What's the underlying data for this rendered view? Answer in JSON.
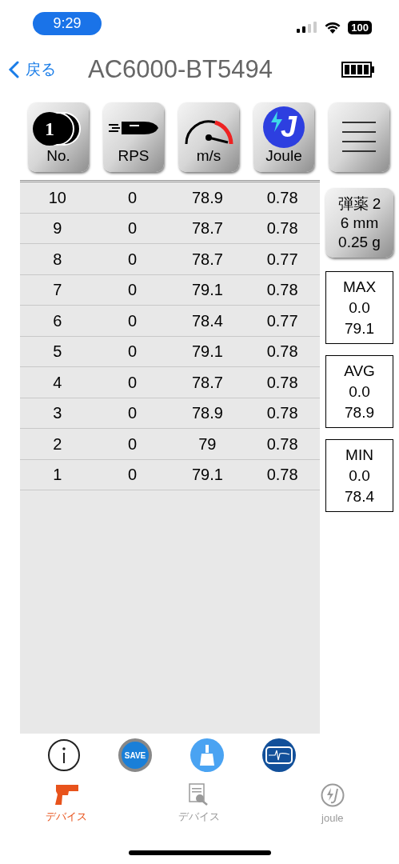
{
  "status_bar": {
    "time": "9:29",
    "battery": "100"
  },
  "nav": {
    "back": "戻る",
    "title": "AC6000-BT5494"
  },
  "toolbar": [
    {
      "kind": "number",
      "label": "No.",
      "glyph": "1"
    },
    {
      "kind": "rps",
      "label": "RPS"
    },
    {
      "kind": "speed",
      "label": "m/s"
    },
    {
      "kind": "joule",
      "label": "Joule",
      "glyph": "J"
    },
    {
      "kind": "menu"
    }
  ],
  "table": {
    "rows": [
      [
        "10",
        "0",
        "78.9",
        "0.78"
      ],
      [
        "9",
        "0",
        "78.7",
        "0.78"
      ],
      [
        "8",
        "0",
        "78.7",
        "0.77"
      ],
      [
        "7",
        "0",
        "79.1",
        "0.78"
      ],
      [
        "6",
        "0",
        "78.4",
        "0.77"
      ],
      [
        "5",
        "0",
        "79.1",
        "0.78"
      ],
      [
        "4",
        "0",
        "78.7",
        "0.78"
      ],
      [
        "3",
        "0",
        "78.9",
        "0.78"
      ],
      [
        "2",
        "0",
        "79",
        "0.78"
      ],
      [
        "1",
        "0",
        "79.1",
        "0.78"
      ]
    ]
  },
  "ammo_button": [
    "弾薬 2",
    "6 mm",
    "0.25 g"
  ],
  "stats": [
    [
      "MAX",
      "0.0",
      "79.1"
    ],
    [
      "AVG",
      "0.0",
      "78.9"
    ],
    [
      "MIN",
      "0.0",
      "78.4"
    ]
  ],
  "actions": [
    {
      "kind": "info"
    },
    {
      "kind": "save",
      "label": "SAVE"
    },
    {
      "kind": "clear"
    },
    {
      "kind": "graph"
    }
  ],
  "tabs": [
    {
      "kind": "gun",
      "label": "デバイス",
      "selected": true
    },
    {
      "kind": "doc",
      "label": "デバイス",
      "selected": false
    },
    {
      "kind": "joule",
      "label": "joule",
      "selected": false
    }
  ]
}
